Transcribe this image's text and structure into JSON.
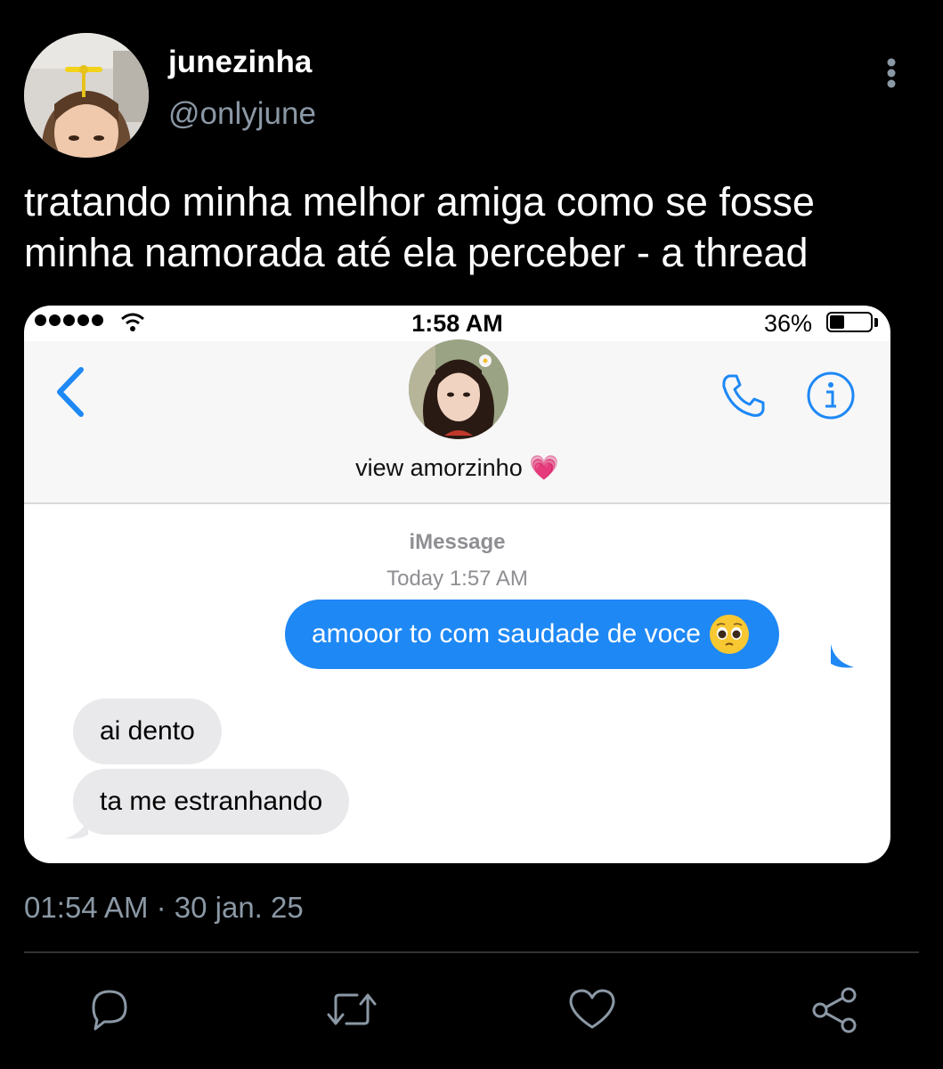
{
  "tweet": {
    "display_name": "junezinha",
    "handle": "@onlyjune",
    "text": "tratando minha melhor amiga como se fosse minha namorada até ela perceber - a thread",
    "timestamp": "01:54 AM · 30 jan. 25"
  },
  "screenshot": {
    "status_bar": {
      "time": "1:58 AM",
      "battery": "36%"
    },
    "contact_name": "view amorzinho 💗",
    "service": "iMessage",
    "time_label": "Today 1:57 AM",
    "messages": [
      {
        "side": "sent",
        "text": "amooor to com saudade de voce"
      },
      {
        "side": "received",
        "text": "ai dento"
      },
      {
        "side": "received",
        "text": "ta me estranhando"
      }
    ]
  },
  "colors": {
    "imessage_blue": "#1e88f5",
    "received_gray": "#e9e9eb",
    "muted": "#8b98a5"
  },
  "icons": [
    "more-vertical-icon",
    "signal-dots-icon",
    "wifi-icon",
    "battery-icon",
    "chevron-left-icon",
    "phone-icon",
    "info-icon",
    "pleading-face-emoji",
    "reply-icon",
    "retweet-icon",
    "like-icon",
    "share-icon"
  ]
}
